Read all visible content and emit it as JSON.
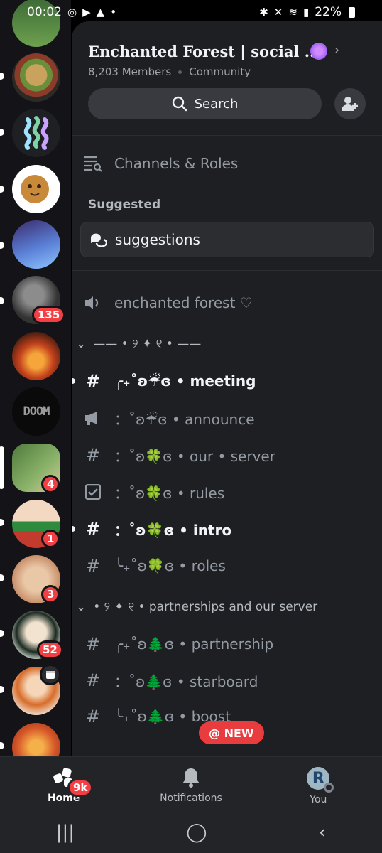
{
  "status_bar": {
    "time": "00:02",
    "battery": "22%"
  },
  "server": {
    "name": "Enchanted Forest | social ...",
    "members": "8,203 Members",
    "type": "Community"
  },
  "search": {
    "label": "Search"
  },
  "channels_roles": "Channels & Roles",
  "suggested": {
    "heading": "Suggested",
    "item": "suggestions"
  },
  "voice_channel": "enchanted forest ♡",
  "category1": "—— • ୨ ✦ ୧ • ——",
  "channels1": [
    {
      "name": "╭₊˚ʚ☔ɞ • meeting"
    },
    {
      "name": "：˚ʚ☔ɞ • announce"
    },
    {
      "name": "：˚ʚ🍀ɞ • our • server"
    },
    {
      "name": "：˚ʚ🍀ɞ • rules"
    },
    {
      "name": "：˚ʚ🍀ɞ • intro"
    },
    {
      "name": "╰₊˚ʚ🍀ɞ • roles"
    }
  ],
  "category2": "• ୨ ✦ ୧ • partnerships and our server",
  "channels2": [
    {
      "name": "╭₊˚ʚ🌲ɞ • partnership"
    },
    {
      "name": "：˚ʚ🌲ɞ • starboard"
    },
    {
      "name": "╰₊˚ʚ🌲ɞ • boost"
    }
  ],
  "new_pill": "@ NEW",
  "server_badges": {
    "s6": "135",
    "s9": "4",
    "s10": "1",
    "s11": "3",
    "s12": "52"
  },
  "tabs": {
    "home": "Home",
    "home_badge": "9k",
    "notifications": "Notifications",
    "you": "You",
    "you_avatar_letter": "R"
  },
  "colors": {
    "badge_red": "#f23f43",
    "panel": "#1e1f22",
    "rail": "#141418"
  }
}
